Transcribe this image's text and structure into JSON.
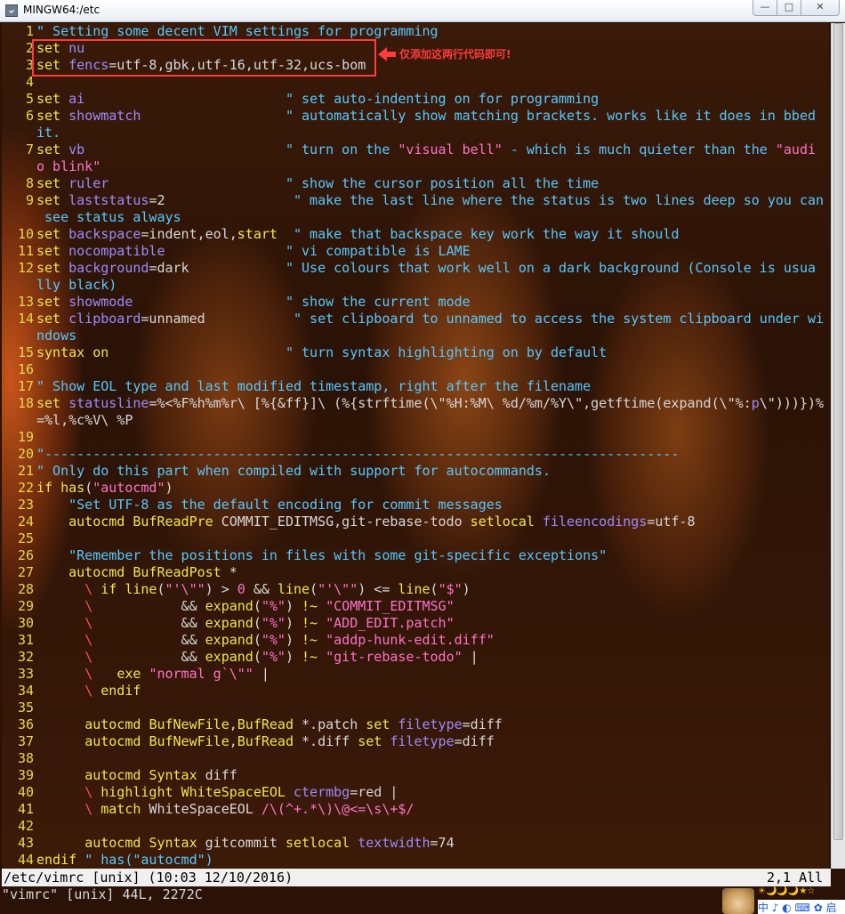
{
  "window": {
    "title": "MINGW64:/etc",
    "buttons": {
      "minimize": "—",
      "maximize": "□",
      "close": "✕"
    },
    "icon": "terminal-icon"
  },
  "annotation": {
    "note": "仅添加这两行代码即可!"
  },
  "colors": {
    "line_number": "#e8d84a",
    "keyword": "#f0e64a",
    "option": "#9b8cff",
    "comment": "#56c9ff",
    "string": "#ff72c8",
    "annotation_red": "#ff3b3b"
  },
  "lines": [
    {
      "n": "1",
      "segs": [
        [
          "c",
          "\" Setting some decent VIM settings for programming"
        ]
      ]
    },
    {
      "n": "2",
      "segs": [
        [
          "k",
          "set"
        ],
        [
          "t",
          " "
        ],
        [
          "o",
          "nu"
        ]
      ]
    },
    {
      "n": "3",
      "segs": [
        [
          "k",
          "set"
        ],
        [
          "t",
          " "
        ],
        [
          "o",
          "fencs"
        ],
        [
          "t",
          "=utf-8,gbk,utf-16,utf-32,ucs-bom"
        ]
      ]
    },
    {
      "n": "4",
      "segs": []
    },
    {
      "n": "5",
      "segs": [
        [
          "k",
          "set"
        ],
        [
          "t",
          " "
        ],
        [
          "o",
          "ai"
        ],
        [
          "t",
          "                         "
        ],
        [
          "c",
          "\" set auto-indenting on for programming"
        ]
      ]
    },
    {
      "n": "6",
      "segs": [
        [
          "k",
          "set"
        ],
        [
          "t",
          " "
        ],
        [
          "o",
          "showmatch"
        ],
        [
          "t",
          "                  "
        ],
        [
          "c",
          "\" automatically show matching brackets. works like it does in bbed"
        ]
      ]
    },
    {
      "n": "",
      "segs": [
        [
          "c",
          "it."
        ]
      ]
    },
    {
      "n": "7",
      "segs": [
        [
          "k",
          "set"
        ],
        [
          "t",
          " "
        ],
        [
          "o",
          "vb"
        ],
        [
          "t",
          "                         "
        ],
        [
          "c",
          "\" turn on the "
        ],
        [
          "s",
          "\"visual bell\""
        ],
        [
          "c",
          " - which is much quieter than the "
        ],
        [
          "s",
          "\"audi"
        ]
      ]
    },
    {
      "n": "",
      "segs": [
        [
          "s",
          "o blink\""
        ]
      ]
    },
    {
      "n": "8",
      "segs": [
        [
          "k",
          "set"
        ],
        [
          "t",
          " "
        ],
        [
          "o",
          "ruler"
        ],
        [
          "t",
          "                      "
        ],
        [
          "c",
          "\" show the cursor position all the time"
        ]
      ]
    },
    {
      "n": "9",
      "segs": [
        [
          "k",
          "set"
        ],
        [
          "t",
          " "
        ],
        [
          "o",
          "laststatus"
        ],
        [
          "t",
          "=2                "
        ],
        [
          "c",
          "\" make the last line where the status is two lines deep so you can"
        ]
      ]
    },
    {
      "n": "",
      "segs": [
        [
          "c",
          " see status always"
        ]
      ]
    },
    {
      "n": "10",
      "segs": [
        [
          "k",
          "set"
        ],
        [
          "t",
          " "
        ],
        [
          "o",
          "backspace"
        ],
        [
          "t",
          "=indent,eol,"
        ],
        [
          "k",
          "start"
        ],
        [
          "t",
          "  "
        ],
        [
          "c",
          "\" make that backspace key work the way it should"
        ]
      ]
    },
    {
      "n": "11",
      "segs": [
        [
          "k",
          "set"
        ],
        [
          "t",
          " "
        ],
        [
          "o",
          "nocompatible"
        ],
        [
          "t",
          "               "
        ],
        [
          "c",
          "\" vi compatible is LAME"
        ]
      ]
    },
    {
      "n": "12",
      "segs": [
        [
          "k",
          "set"
        ],
        [
          "t",
          " "
        ],
        [
          "o",
          "background"
        ],
        [
          "t",
          "=dark            "
        ],
        [
          "c",
          "\" Use colours that work well on a dark background (Console is usua"
        ]
      ]
    },
    {
      "n": "",
      "segs": [
        [
          "c",
          "lly black)"
        ]
      ]
    },
    {
      "n": "13",
      "segs": [
        [
          "k",
          "set"
        ],
        [
          "t",
          " "
        ],
        [
          "o",
          "showmode"
        ],
        [
          "t",
          "                   "
        ],
        [
          "c",
          "\" show the current mode"
        ]
      ]
    },
    {
      "n": "14",
      "segs": [
        [
          "k",
          "set"
        ],
        [
          "t",
          " "
        ],
        [
          "o",
          "clipboard"
        ],
        [
          "t",
          "=unnamed           "
        ],
        [
          "c",
          "\" set clipboard to unnamed to access the system clipboard under wi"
        ]
      ]
    },
    {
      "n": "",
      "segs": [
        [
          "c",
          "ndows"
        ]
      ]
    },
    {
      "n": "15",
      "segs": [
        [
          "k",
          "syntax"
        ],
        [
          "t",
          " "
        ],
        [
          "k",
          "on"
        ],
        [
          "t",
          "                      "
        ],
        [
          "c",
          "\" turn syntax highlighting on by default"
        ]
      ]
    },
    {
      "n": "16",
      "segs": []
    },
    {
      "n": "17",
      "segs": [
        [
          "c",
          "\" Show EOL type and last modified timestamp, right after the filename"
        ]
      ]
    },
    {
      "n": "18",
      "segs": [
        [
          "k",
          "set"
        ],
        [
          "t",
          " "
        ],
        [
          "o",
          "statusline"
        ],
        [
          "t",
          "=%<%F%h%m%r\\ [%{&ff}]\\ (%{strftime(\\\"%H:%M\\ %d/%m/%Y\\\",getftime(expand(\\\"%:"
        ],
        [
          "o",
          "p"
        ],
        [
          "t",
          "\\\")))})%"
        ]
      ]
    },
    {
      "n": "",
      "segs": [
        [
          "t",
          "=%l,%c%V\\ %P"
        ]
      ]
    },
    {
      "n": "19",
      "segs": []
    },
    {
      "n": "20",
      "segs": [
        [
          "c",
          "\"-------------------------------------------------------------------------------"
        ]
      ]
    },
    {
      "n": "21",
      "segs": [
        [
          "c",
          "\" Only do this part when compiled with support for autocommands."
        ]
      ]
    },
    {
      "n": "22",
      "segs": [
        [
          "k",
          "if"
        ],
        [
          "t",
          " "
        ],
        [
          "k",
          "has"
        ],
        [
          "t",
          "("
        ],
        [
          "s",
          "\"autocmd\""
        ],
        [
          "t",
          ")"
        ]
      ]
    },
    {
      "n": "23",
      "segs": [
        [
          "t",
          "    "
        ],
        [
          "c",
          "\"Set UTF-8 as the default encoding for commit messages"
        ]
      ]
    },
    {
      "n": "24",
      "segs": [
        [
          "t",
          "    "
        ],
        [
          "k",
          "autocmd"
        ],
        [
          "t",
          " "
        ],
        [
          "k",
          "BufReadPre"
        ],
        [
          "t",
          " COMMIT_EDITMSG,git-rebase-todo "
        ],
        [
          "k",
          "setlocal"
        ],
        [
          "t",
          " "
        ],
        [
          "o",
          "fileencodings"
        ],
        [
          "t",
          "=utf-8"
        ]
      ]
    },
    {
      "n": "25",
      "segs": []
    },
    {
      "n": "26",
      "segs": [
        [
          "t",
          "    "
        ],
        [
          "c",
          "\"Remember the positions in files with some git-specific exceptions\""
        ]
      ]
    },
    {
      "n": "27",
      "segs": [
        [
          "t",
          "    "
        ],
        [
          "k",
          "autocmd"
        ],
        [
          "t",
          " "
        ],
        [
          "k",
          "BufReadPost"
        ],
        [
          "t",
          " *"
        ]
      ]
    },
    {
      "n": "28",
      "segs": [
        [
          "t",
          "      "
        ],
        [
          "sp",
          "\\"
        ],
        [
          "t",
          " "
        ],
        [
          "k",
          "if"
        ],
        [
          "t",
          " "
        ],
        [
          "k",
          "line"
        ],
        [
          "t",
          "("
        ],
        [
          "s",
          "\"'\\\"\""
        ],
        [
          "t",
          ") > "
        ],
        [
          "s",
          "0"
        ],
        [
          "t",
          " && "
        ],
        [
          "k",
          "line"
        ],
        [
          "t",
          "("
        ],
        [
          "s",
          "\"'\\\"\""
        ],
        [
          "t",
          ") <= "
        ],
        [
          "k",
          "line"
        ],
        [
          "t",
          "("
        ],
        [
          "s",
          "\"$\""
        ],
        [
          "t",
          ")"
        ]
      ]
    },
    {
      "n": "29",
      "segs": [
        [
          "t",
          "      "
        ],
        [
          "sp",
          "\\"
        ],
        [
          "t",
          "           && "
        ],
        [
          "k",
          "expand"
        ],
        [
          "t",
          "("
        ],
        [
          "s",
          "\"%\""
        ],
        [
          "t",
          ") "
        ],
        [
          "k",
          "!~"
        ],
        [
          "t",
          " "
        ],
        [
          "s",
          "\"COMMIT_EDITMSG\""
        ]
      ]
    },
    {
      "n": "30",
      "segs": [
        [
          "t",
          "      "
        ],
        [
          "sp",
          "\\"
        ],
        [
          "t",
          "           && "
        ],
        [
          "k",
          "expand"
        ],
        [
          "t",
          "("
        ],
        [
          "s",
          "\"%\""
        ],
        [
          "t",
          ") "
        ],
        [
          "k",
          "!~"
        ],
        [
          "t",
          " "
        ],
        [
          "s",
          "\"ADD_EDIT.patch\""
        ]
      ]
    },
    {
      "n": "31",
      "segs": [
        [
          "t",
          "      "
        ],
        [
          "sp",
          "\\"
        ],
        [
          "t",
          "           && "
        ],
        [
          "k",
          "expand"
        ],
        [
          "t",
          "("
        ],
        [
          "s",
          "\"%\""
        ],
        [
          "t",
          ") "
        ],
        [
          "k",
          "!~"
        ],
        [
          "t",
          " "
        ],
        [
          "s",
          "\"addp-hunk-edit.diff\""
        ]
      ]
    },
    {
      "n": "32",
      "segs": [
        [
          "t",
          "      "
        ],
        [
          "sp",
          "\\"
        ],
        [
          "t",
          "           && "
        ],
        [
          "k",
          "expand"
        ],
        [
          "t",
          "("
        ],
        [
          "s",
          "\"%\""
        ],
        [
          "t",
          ") "
        ],
        [
          "k",
          "!~"
        ],
        [
          "t",
          " "
        ],
        [
          "s",
          "\"git-rebase-todo\""
        ],
        [
          "t",
          " |"
        ]
      ]
    },
    {
      "n": "33",
      "segs": [
        [
          "t",
          "      "
        ],
        [
          "sp",
          "\\"
        ],
        [
          "t",
          "   "
        ],
        [
          "k",
          "exe"
        ],
        [
          "t",
          " "
        ],
        [
          "s",
          "\"normal g`\\\"\""
        ],
        [
          "t",
          " |"
        ]
      ]
    },
    {
      "n": "34",
      "segs": [
        [
          "t",
          "      "
        ],
        [
          "sp",
          "\\"
        ],
        [
          "t",
          " "
        ],
        [
          "k",
          "endif"
        ]
      ]
    },
    {
      "n": "35",
      "segs": []
    },
    {
      "n": "36",
      "segs": [
        [
          "t",
          "      "
        ],
        [
          "k",
          "autocmd"
        ],
        [
          "t",
          " "
        ],
        [
          "k",
          "BufNewFile"
        ],
        [
          "t",
          ","
        ],
        [
          "k",
          "BufRead"
        ],
        [
          "t",
          " *.patch "
        ],
        [
          "k",
          "set"
        ],
        [
          "t",
          " "
        ],
        [
          "o",
          "filetype"
        ],
        [
          "t",
          "=diff"
        ]
      ]
    },
    {
      "n": "37",
      "segs": [
        [
          "t",
          "      "
        ],
        [
          "k",
          "autocmd"
        ],
        [
          "t",
          " "
        ],
        [
          "k",
          "BufNewFile"
        ],
        [
          "t",
          ","
        ],
        [
          "k",
          "BufRead"
        ],
        [
          "t",
          " *.diff "
        ],
        [
          "k",
          "set"
        ],
        [
          "t",
          " "
        ],
        [
          "o",
          "filetype"
        ],
        [
          "t",
          "=diff"
        ]
      ]
    },
    {
      "n": "38",
      "segs": []
    },
    {
      "n": "39",
      "segs": [
        [
          "t",
          "      "
        ],
        [
          "k",
          "autocmd"
        ],
        [
          "t",
          " "
        ],
        [
          "k",
          "Syntax"
        ],
        [
          "t",
          " diff"
        ]
      ]
    },
    {
      "n": "40",
      "segs": [
        [
          "t",
          "      "
        ],
        [
          "sp",
          "\\"
        ],
        [
          "t",
          " "
        ],
        [
          "k",
          "highlight"
        ],
        [
          "t",
          " "
        ],
        [
          "k",
          "WhiteSpaceEOL"
        ],
        [
          "t",
          " "
        ],
        [
          "o",
          "ctermbg"
        ],
        [
          "t",
          "=red |"
        ]
      ]
    },
    {
      "n": "41",
      "segs": [
        [
          "t",
          "      "
        ],
        [
          "sp",
          "\\"
        ],
        [
          "t",
          " "
        ],
        [
          "k",
          "match"
        ],
        [
          "t",
          " WhiteSpaceEOL "
        ],
        [
          "s",
          "/\\(^+.*\\)\\@<=\\s\\+$/"
        ]
      ]
    },
    {
      "n": "42",
      "segs": []
    },
    {
      "n": "43",
      "segs": [
        [
          "t",
          "      "
        ],
        [
          "k",
          "autocmd"
        ],
        [
          "t",
          " "
        ],
        [
          "k",
          "Syntax"
        ],
        [
          "t",
          " gitcommit "
        ],
        [
          "k",
          "setlocal"
        ],
        [
          "t",
          " "
        ],
        [
          "o",
          "textwidth"
        ],
        [
          "t",
          "=74"
        ]
      ]
    },
    {
      "n": "44",
      "segs": [
        [
          "k",
          "endif"
        ],
        [
          "t",
          " "
        ],
        [
          "c",
          "\" has(\"autocmd\")"
        ]
      ]
    }
  ],
  "statusline": {
    "left": "/etc/vimrc [unix] (10:03 12/10/2016)",
    "right": "2,1 All"
  },
  "cmdline": "\"vimrc\" [unix] 44L, 2272C",
  "tray": {
    "icons": "☀🌙🌙🌙★☆",
    "ime": "中 ♪ ◐ ⌨ ✿ 启"
  }
}
